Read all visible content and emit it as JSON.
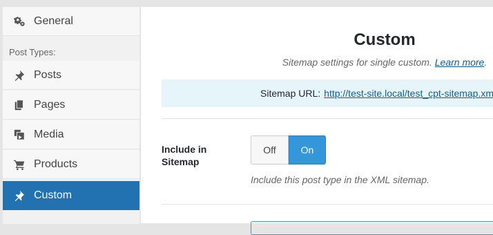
{
  "sidebar": {
    "items": [
      {
        "label": "General",
        "icon": "gears-icon"
      },
      {
        "label": "Posts",
        "icon": "pushpin-icon"
      },
      {
        "label": "Pages",
        "icon": "pages-icon"
      },
      {
        "label": "Media",
        "icon": "media-icon"
      },
      {
        "label": "Products",
        "icon": "cart-icon"
      },
      {
        "label": "Custom",
        "icon": "pushpin-icon",
        "active": true
      }
    ],
    "section_label": "Post Types:"
  },
  "main": {
    "title": "Custom",
    "subtitle": "Sitemap settings for single custom.",
    "learn_more": "Learn more",
    "subtitle_end": ".",
    "sitemap_url_label": "Sitemap URL:",
    "sitemap_url": "http://test-site.local/test_cpt-sitemap.xml",
    "include_label": "Include in Sitemap",
    "toggle_off": "Off",
    "toggle_on": "On",
    "toggle_value": "On",
    "help_text": "Include this post type in the XML sitemap."
  },
  "colors": {
    "accent": "#2271b1",
    "toggle_on": "#3497da",
    "url_box_bg": "#e5f5fa",
    "link": "#135e96"
  }
}
